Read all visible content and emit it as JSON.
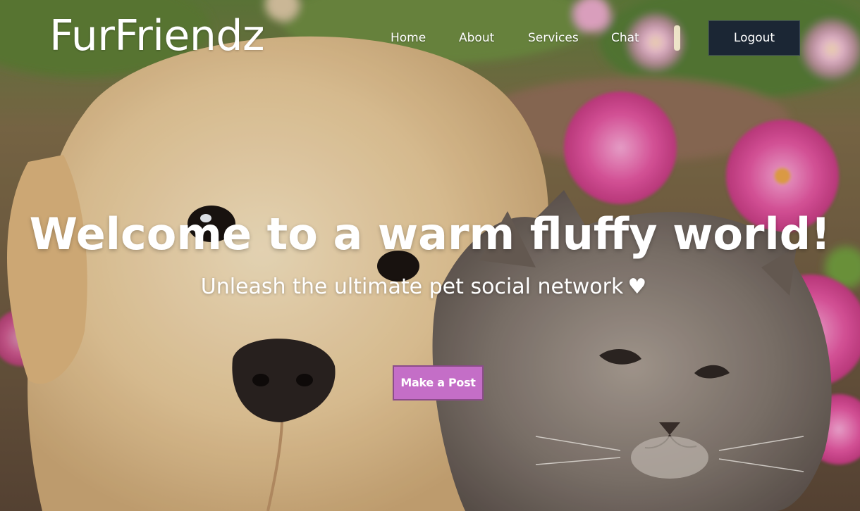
{
  "brand": {
    "name": "FurFriendz"
  },
  "nav": {
    "links": [
      {
        "label": "Home"
      },
      {
        "label": "About"
      },
      {
        "label": "Services"
      },
      {
        "label": "Chat"
      }
    ],
    "logout_label": "Logout"
  },
  "hero": {
    "headline": "Welcome to a warm fluffy world!",
    "subheadline": "Unleash the ultimate pet social network",
    "heart_glyph": "♥",
    "cta_label": "Make a Post",
    "background_image": "photo-puppy-and-kitten-among-pink-flowers"
  },
  "colors": {
    "logout_bg": "#1b2634",
    "cta_bg": "#c46ec7",
    "cta_border": "#8b4c8a",
    "text": "#ffffff"
  }
}
